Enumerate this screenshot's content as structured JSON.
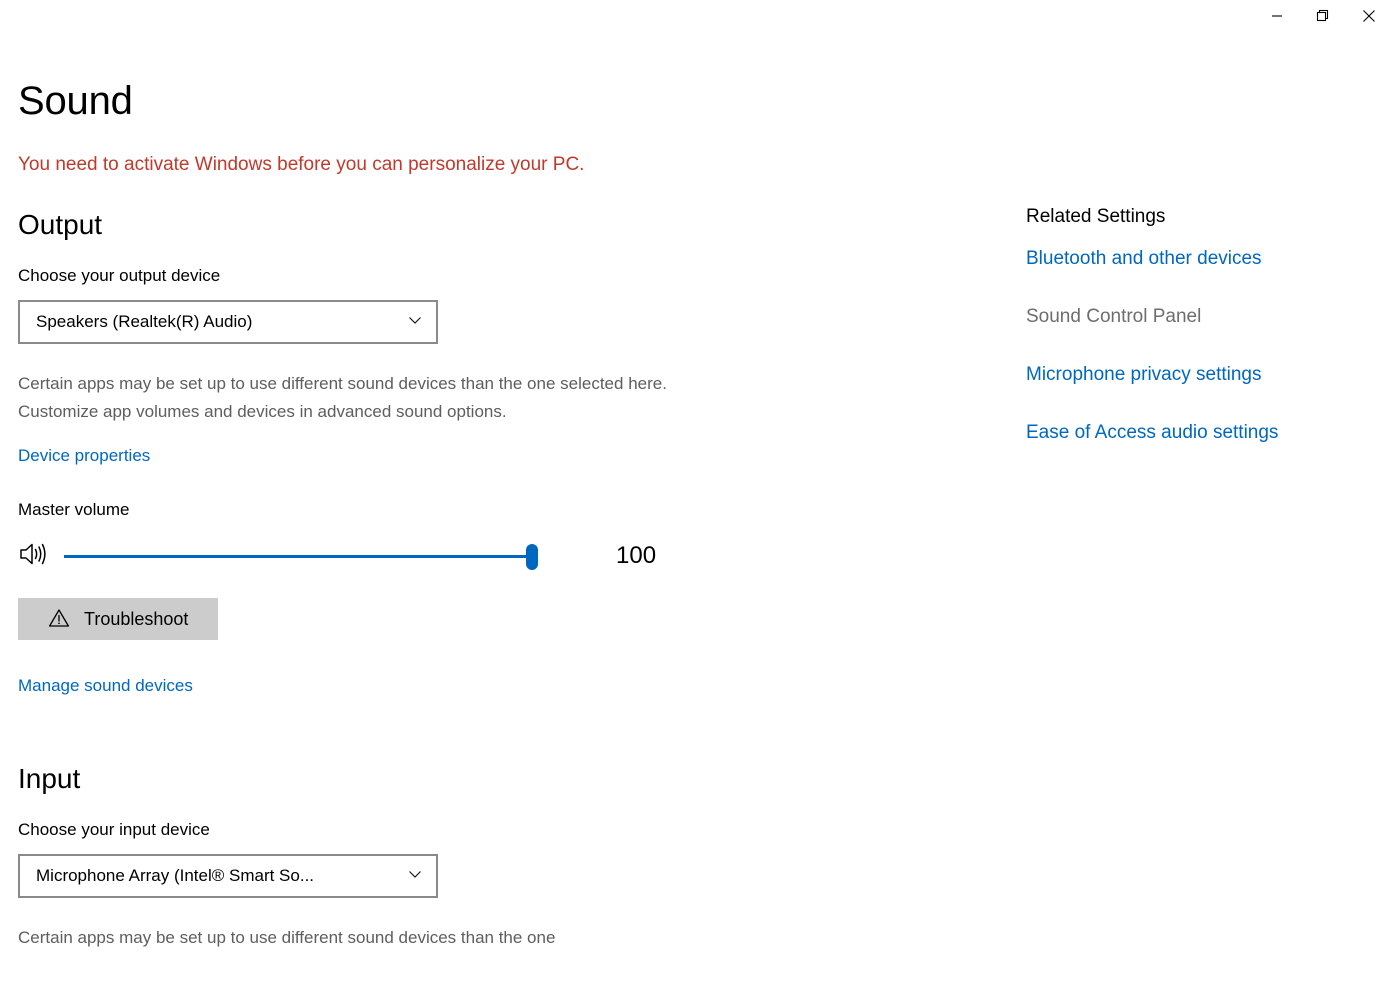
{
  "window": {
    "controls": [
      {
        "name": "minimize",
        "glyph": "minimize-icon"
      },
      {
        "name": "restore",
        "glyph": "restore-icon"
      },
      {
        "name": "close",
        "glyph": "close-icon"
      }
    ]
  },
  "page": {
    "title": "Sound",
    "activation_warning": "You need to activate Windows before you can personalize your PC."
  },
  "output": {
    "heading": "Output",
    "device_label": "Choose your output device",
    "device_value": "Speakers (Realtek(R) Audio)",
    "description": "Certain apps may be set up to use different sound devices than the one selected here. Customize app volumes and devices in advanced sound options.",
    "device_properties_link": "Device properties",
    "volume_label": "Master volume",
    "volume_value": "100",
    "volume_percent": 100,
    "speaker_icon": "speaker-volume-icon",
    "troubleshoot_label": "Troubleshoot",
    "troubleshoot_icon": "warning-triangle-icon",
    "manage_link": "Manage sound devices"
  },
  "input": {
    "heading": "Input",
    "device_label": "Choose your input device",
    "device_value": "Microphone Array (Intel® Smart So...",
    "description": "Certain apps may be set up to use different sound devices than the one"
  },
  "related": {
    "title": "Related Settings",
    "items": [
      {
        "label": "Bluetooth and other devices",
        "state": "enabled"
      },
      {
        "label": "Sound Control Panel",
        "state": "disabled"
      },
      {
        "label": "Microphone privacy settings",
        "state": "enabled"
      },
      {
        "label": "Ease of Access audio settings",
        "state": "enabled"
      }
    ]
  },
  "colors": {
    "accent": "#0067c0",
    "warning_red": "#c0392b",
    "disabled_text": "#6d6d6d",
    "body_text": "#5e5e5e",
    "button_bg": "#cccccc",
    "combo_border": "#8a8a8a"
  }
}
